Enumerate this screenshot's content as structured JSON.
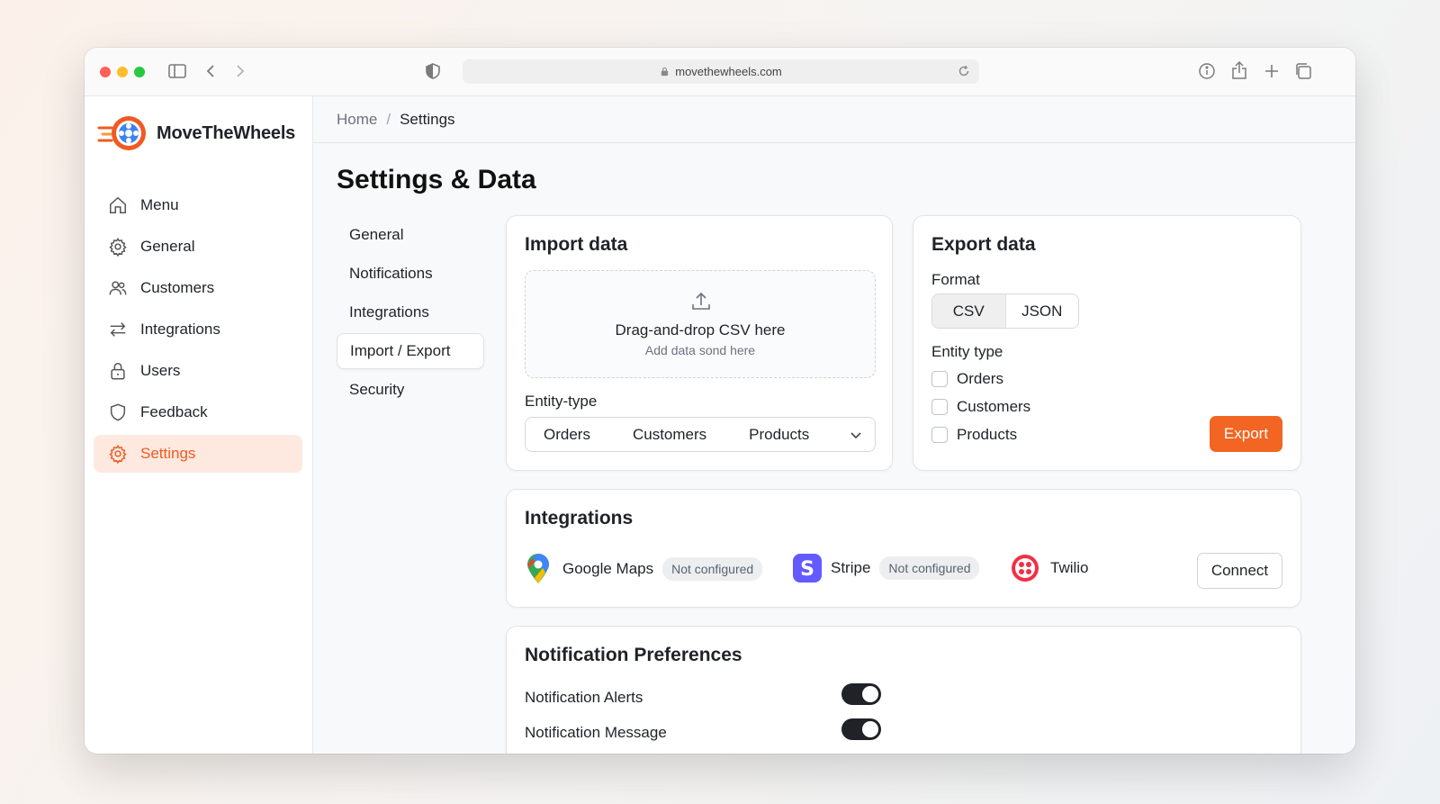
{
  "browser": {
    "url": "movethewheels.com",
    "traffic_lights": [
      "#ff5f57",
      "#febc2e",
      "#28c840"
    ]
  },
  "brand": {
    "name": "MoveTheWheels",
    "accent": "#f05a22"
  },
  "sidebar": {
    "items": [
      {
        "label": "Menu",
        "icon": "home-icon"
      },
      {
        "label": "General",
        "icon": "gear-icon"
      },
      {
        "label": "Customers",
        "icon": "users-icon"
      },
      {
        "label": "Integrations",
        "icon": "arrows-swap-icon"
      },
      {
        "label": "Users",
        "icon": "lock-icon"
      },
      {
        "label": "Feedback",
        "icon": "shield-icon"
      },
      {
        "label": "Settings",
        "icon": "gear-icon",
        "active": true
      }
    ]
  },
  "breadcrumb": {
    "home": "Home",
    "separator": "/",
    "current": "Settings"
  },
  "page": {
    "title": "Settings & Data"
  },
  "subnav": {
    "items": [
      {
        "label": "General"
      },
      {
        "label": "Notifications"
      },
      {
        "label": "Integrations"
      },
      {
        "label": "Import / Export",
        "active": true
      },
      {
        "label": "Security"
      }
    ]
  },
  "import_card": {
    "title": "Import data",
    "drop_main": "Drag-and-drop CSV here",
    "drop_sub": "Add data sond here",
    "entity_label": "Entity-type",
    "entity_options": [
      "Orders",
      "Customers",
      "Products"
    ]
  },
  "export_card": {
    "title": "Export data",
    "format_label": "Format",
    "formats": [
      "CSV",
      "JSON"
    ],
    "selected_format": "CSV",
    "entity_label": "Entity type",
    "entities": [
      {
        "label": "Orders",
        "checked": false
      },
      {
        "label": "Customers",
        "checked": false
      },
      {
        "label": "Products",
        "checked": false
      }
    ],
    "export_button": "Export"
  },
  "integrations_card": {
    "title": "Integrations",
    "items": [
      {
        "name": "Google Maps",
        "status": "Not configured",
        "icon": "google-maps-icon"
      },
      {
        "name": "Stripe",
        "status": "Not configured",
        "icon": "stripe-icon"
      },
      {
        "name": "Twilio",
        "icon": "twilio-icon"
      }
    ],
    "connect_button": "Connect"
  },
  "notifications_card": {
    "title": "Notification Preferences",
    "toggles": [
      {
        "label": "Notification Alerts",
        "on": true
      },
      {
        "label": "Notification Message",
        "on": true
      }
    ]
  }
}
